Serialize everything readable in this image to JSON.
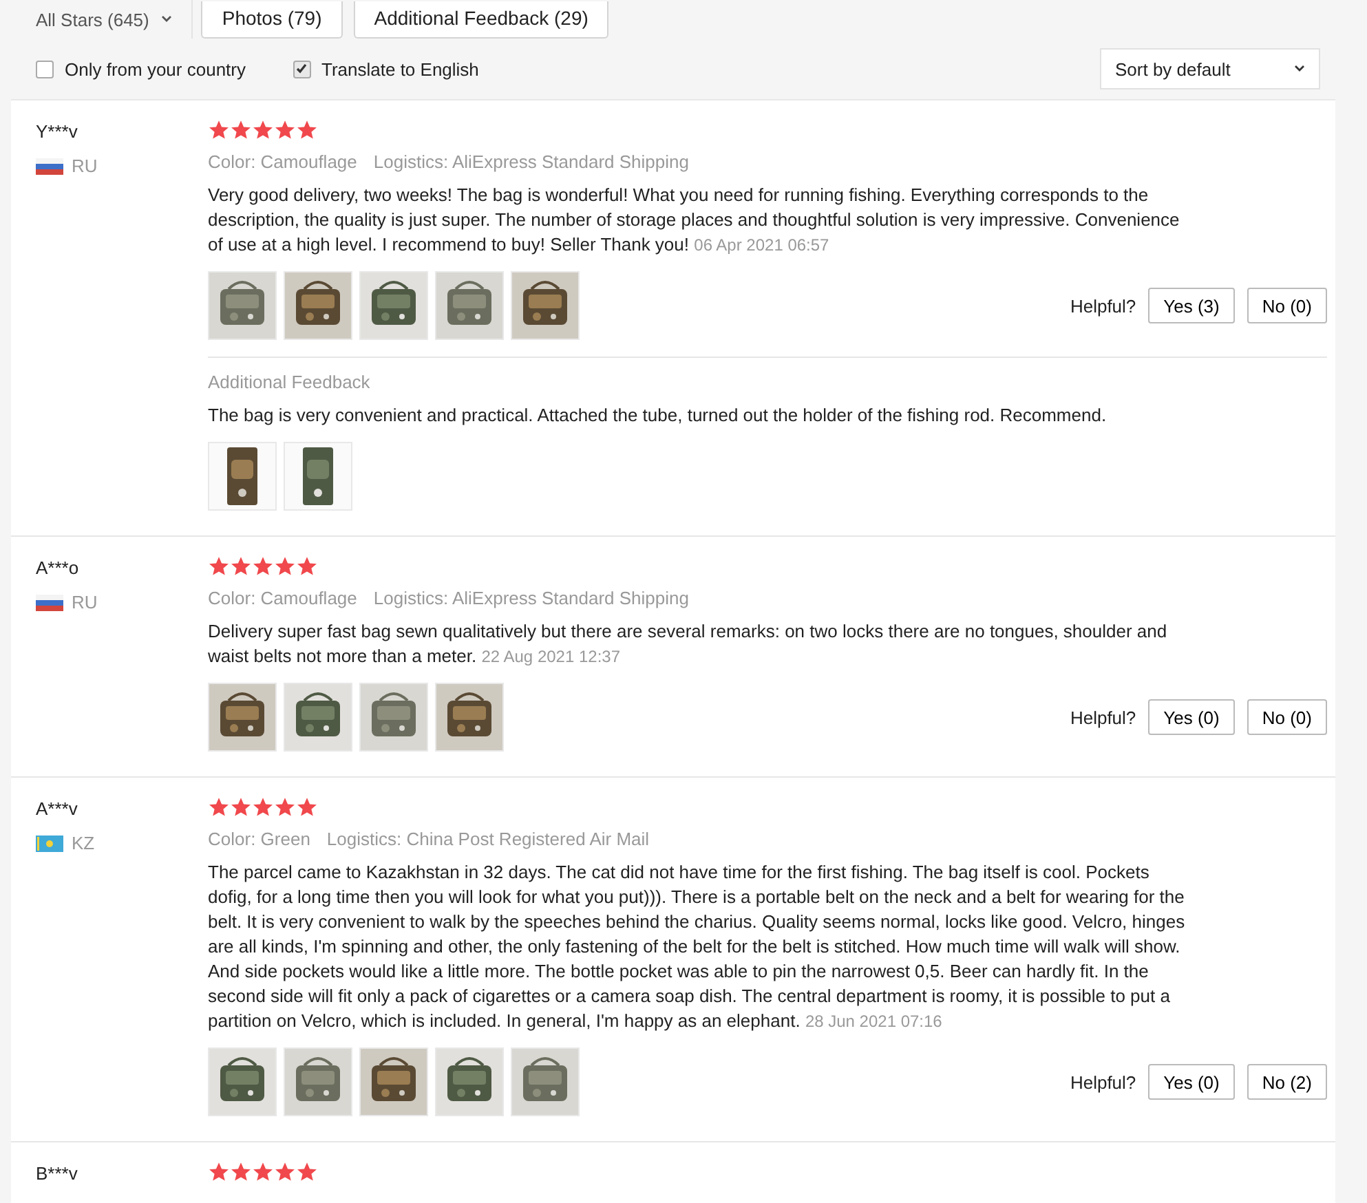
{
  "filter_bar": {
    "stars_dropdown": "All Stars (645)",
    "tabs": [
      {
        "label": "Photos (79)",
        "selected": false
      },
      {
        "label": "Additional Feedback (29)",
        "selected": false
      }
    ]
  },
  "options": [
    {
      "label": "Only from your country",
      "checked": false
    },
    {
      "label": "Translate to English",
      "checked": true
    }
  ],
  "sort": {
    "label": "Sort by default"
  },
  "reviews": [
    {
      "user": "Y***v",
      "flag": {
        "kind": "tricolor"
      },
      "country": "RU",
      "stars": 5,
      "variant": "Color: Camouflage",
      "logistics": "Logistics: AliExpress Standard Shipping",
      "text": "Very good delivery, two weeks! The bag is wonderful! What you need for running fishing. Everything corresponds to the description, the quality is just super. The number of storage places and thoughtful solution is very impressive. Convenience of use at a high level. I recommend to buy! Seller Thank you!",
      "date": "06 Apr 2021 06:57",
      "photos": [
        {
          "kind": "picture"
        },
        {
          "kind": "picture"
        },
        {
          "kind": "picture"
        },
        {
          "kind": "picture"
        },
        {
          "kind": "picture"
        }
      ],
      "helpful": "Helpful?",
      "yes": "Yes (3)",
      "no": "No (0)",
      "additional": {
        "title": "Additional Feedback",
        "text": "The bag is very convenient and practical. Attached the tube, turned out the holder of the fishing rod. Recommend.",
        "photos": [
          {
            "kind": "picture"
          },
          {
            "kind": "picture"
          }
        ]
      }
    },
    {
      "user": "A***o",
      "flag": {
        "kind": "tricolor"
      },
      "country": "RU",
      "stars": 5,
      "variant": "Color: Camouflage",
      "logistics": "Logistics: AliExpress Standard Shipping",
      "text": "Delivery super fast bag sewn qualitatively but there are several remarks: on two locks there are no tongues, shoulder and waist belts not more than a meter.",
      "date": "22 Aug 2021 12:37",
      "photos": [
        {
          "kind": "picture"
        },
        {
          "kind": "picture"
        },
        {
          "kind": "picture"
        },
        {
          "kind": "picture"
        }
      ],
      "helpful": "Helpful?",
      "yes": "Yes (0)",
      "no": "No (0)"
    },
    {
      "user": "A***v",
      "flag": {
        "kind": "sun"
      },
      "country": "KZ",
      "stars": 5,
      "variant": "Color: Green",
      "logistics": "Logistics: China Post Registered Air Mail",
      "text": "The parcel came to Kazakhstan in 32 days. The cat did not have time for the first fishing. The bag itself is cool. Pockets dofig, for a long time then you will look for what you put))). There is a portable belt on the neck and a belt for wearing for the belt. It is very convenient to walk by the speeches behind the charius. Quality seems normal, locks like good. Velcro, hinges are all kinds, I'm spinning and other, the only fastening of the belt for the belt is stitched. How much time will walk will show. And side pockets would like a little more. The bottle pocket was able to pin the narrowest 0,5. Beer can hardly fit. In the second side will fit only a pack of cigarettes or a camera soap dish. The central department is roomy, it is possible to put a partition on Velcro, which is included. In general, I'm happy as an elephant.",
      "date": "28 Jun 2021 07:16",
      "photos": [
        {
          "kind": "picture"
        },
        {
          "kind": "picture"
        },
        {
          "kind": "picture"
        },
        {
          "kind": "picture"
        },
        {
          "kind": "picture"
        }
      ],
      "helpful": "Helpful?",
      "yes": "Yes (0)",
      "no": "No (2)"
    },
    {
      "user": "B***v",
      "stars": 5
    }
  ]
}
